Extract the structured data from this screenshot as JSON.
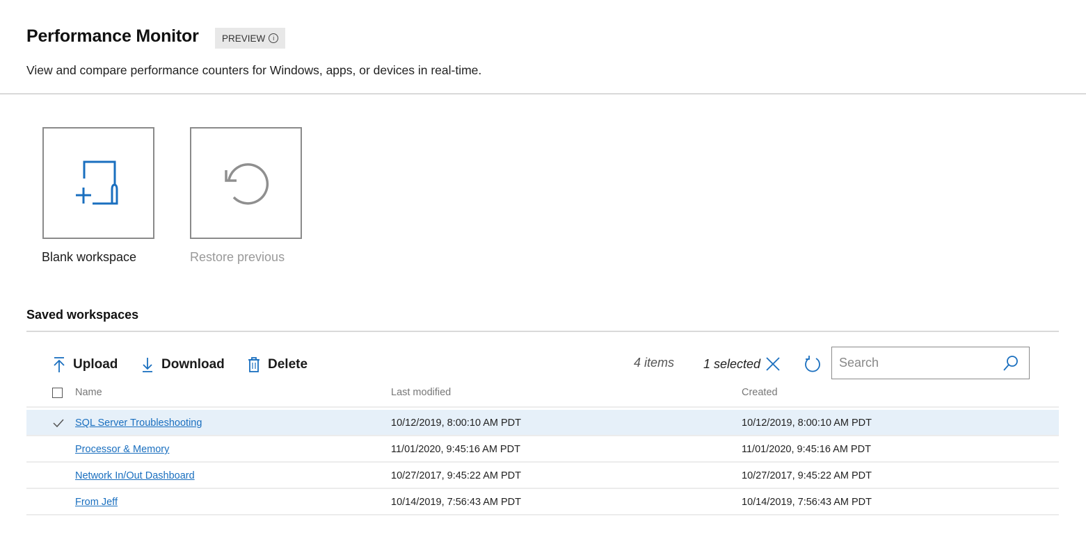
{
  "header": {
    "title": "Performance Monitor",
    "badge": "PREVIEW",
    "subtitle": "View and compare performance counters for Windows, apps, or devices in real-time."
  },
  "tiles": [
    {
      "label": "Blank workspace",
      "icon": "blank-workspace-icon",
      "enabled": true
    },
    {
      "label": "Restore previous",
      "icon": "restore-icon",
      "enabled": false
    }
  ],
  "saved": {
    "heading": "Saved workspaces",
    "toolbar": {
      "upload": "Upload",
      "download": "Download",
      "delete": "Delete",
      "item_count": "4 items",
      "selected": "1 selected",
      "search_placeholder": "Search"
    },
    "columns": {
      "name": "Name",
      "modified": "Last modified",
      "created": "Created"
    },
    "rows": [
      {
        "name": "SQL Server Troubleshooting",
        "modified": "10/12/2019, 8:00:10 AM PDT",
        "created": "10/12/2019, 8:00:10 AM PDT",
        "selected": true
      },
      {
        "name": "Processor & Memory",
        "modified": "11/01/2020, 9:45:16 AM PDT",
        "created": "11/01/2020, 9:45:16 AM PDT",
        "selected": false
      },
      {
        "name": "Network In/Out Dashboard",
        "modified": "10/27/2017, 9:45:22 AM PDT",
        "created": "10/27/2017, 9:45:22 AM PDT",
        "selected": false
      },
      {
        "name": "From Jeff",
        "modified": "10/14/2019, 7:56:43 AM PDT",
        "created": "10/14/2019, 7:56:43 AM PDT",
        "selected": false
      }
    ]
  },
  "colors": {
    "accent": "#1a6fbf",
    "selected_row": "#e6f0f9",
    "disabled_text": "#999999"
  }
}
